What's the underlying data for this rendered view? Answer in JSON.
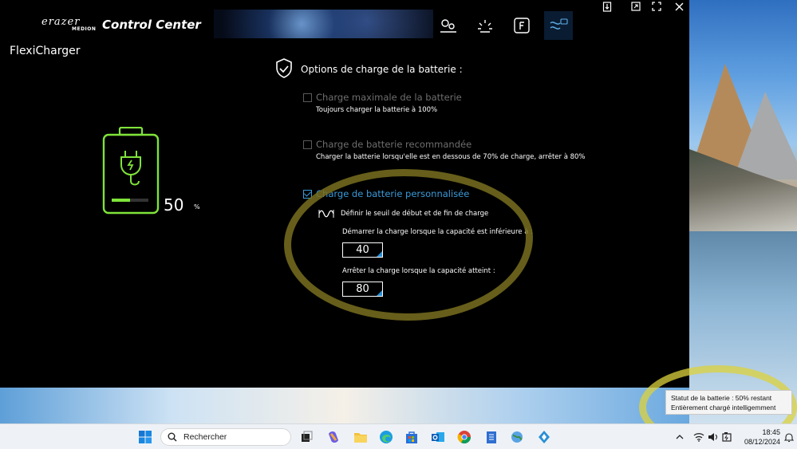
{
  "window": {
    "brand_erazer": "erazer",
    "brand_medion": "MEDION",
    "app_title": "Control Center",
    "page_title": "FlexiCharger"
  },
  "nav": {
    "icons": [
      "performance-settings-icon",
      "display-brightness-icon",
      "function-key-icon",
      "battery-charge-icon"
    ],
    "active": "battery-charge-icon"
  },
  "battery": {
    "level_percent": 50,
    "value": "50",
    "unit": "%",
    "accent": "#7fe33a"
  },
  "options": {
    "header": "Options de charge de la batterie :",
    "items": [
      {
        "label": "Charge maximale de la batterie",
        "description": "Toujours charger la batterie à 100%",
        "checked": false
      },
      {
        "label": "Charge de batterie recommandée",
        "description": "Charger la batterie lorsqu'elle est en dessous de 70% de charge, arrêter à 80%",
        "checked": false
      },
      {
        "label": "Charge de batterie personnalisée",
        "checked": true
      }
    ],
    "custom": {
      "threshold_title": "Définir le seuil de début et de fin de charge",
      "start_label": "Démarrer la charge lorsque la capacité est inférieure à :",
      "start_value": "40",
      "stop_label": "Arrêter la charge lorsque la capacité atteint :",
      "stop_value": "80"
    }
  },
  "tooltip": {
    "line1": "Statut de la batterie : 50% restant",
    "line2": "Entièrement chargé intelligemment"
  },
  "taskbar": {
    "search_placeholder": "Rechercher",
    "time": "18:45",
    "date": "08/12/2024"
  },
  "colors": {
    "accent_blue": "#3a9ad9",
    "annotation": "#786e1e"
  }
}
